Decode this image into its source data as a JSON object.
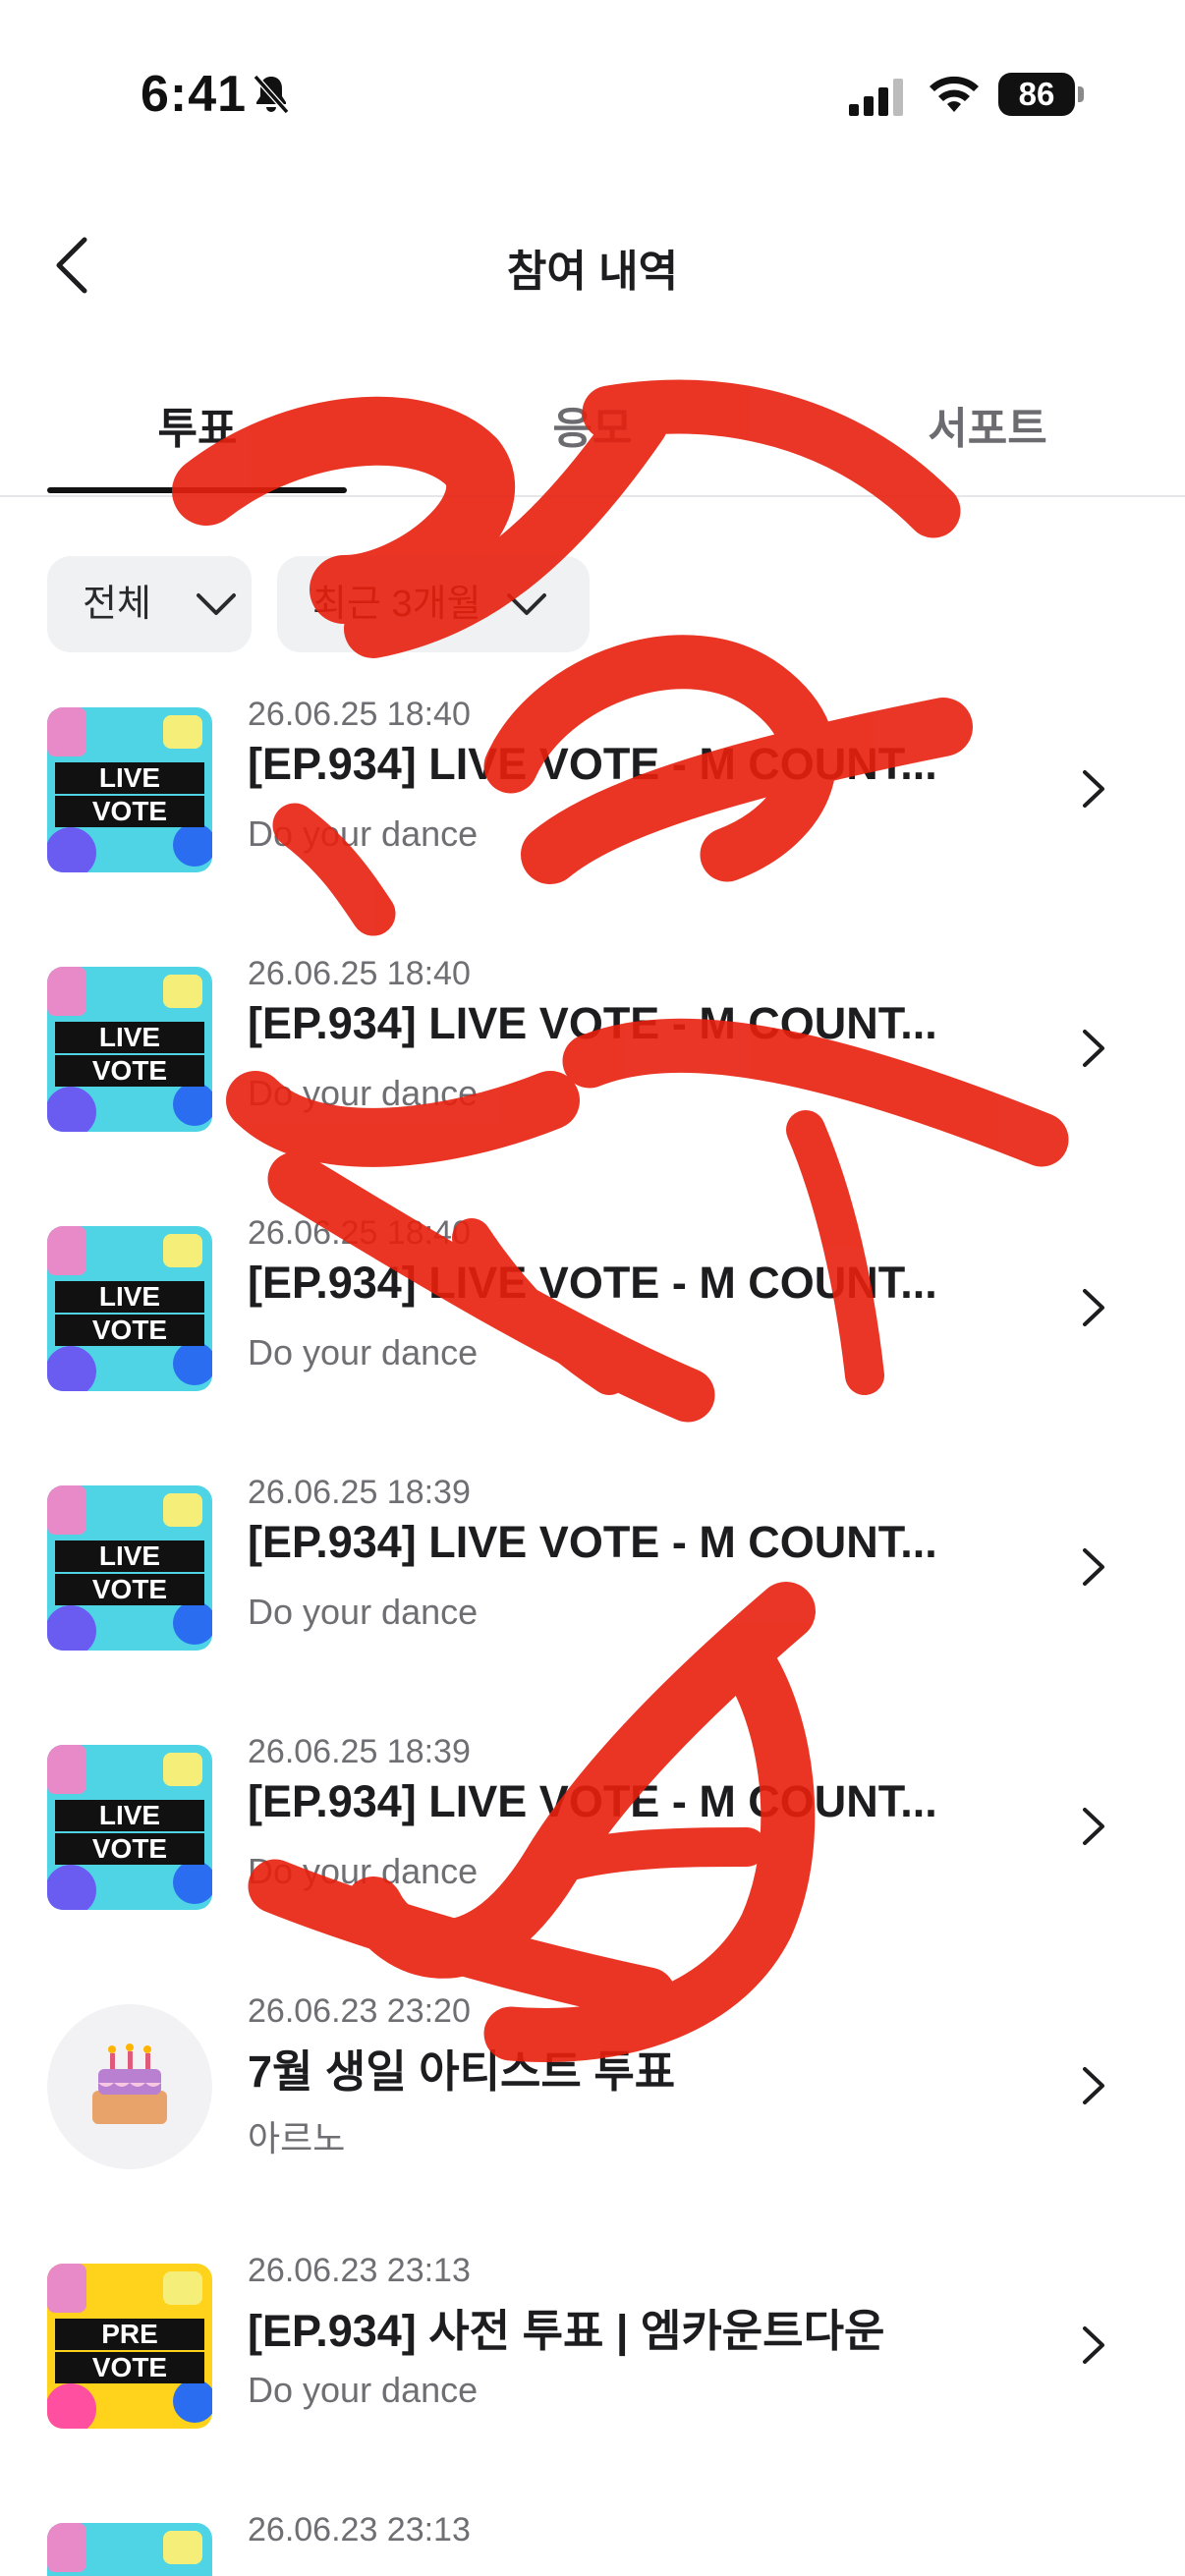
{
  "status_bar": {
    "time": "6:41",
    "battery": "86"
  },
  "header": {
    "title": "참여 내역"
  },
  "tabs": [
    {
      "label": "투표"
    },
    {
      "label": "응모"
    },
    {
      "label": "서포트"
    }
  ],
  "filters": [
    {
      "label": "전체"
    },
    {
      "label": "최근 3개월"
    }
  ],
  "items": [
    {
      "date": "26.06.25 18:40",
      "title": "[EP.934] LIVE VOTE - M COUNT...",
      "subtitle": "Do your dance",
      "thumb_line1": "LIVE",
      "thumb_line2": "VOTE"
    },
    {
      "date": "26.06.25 18:40",
      "title": "[EP.934] LIVE VOTE - M COUNT...",
      "subtitle": "Do your dance",
      "thumb_line1": "LIVE",
      "thumb_line2": "VOTE"
    },
    {
      "date": "26.06.25 18:40",
      "title": "[EP.934] LIVE VOTE - M COUNT...",
      "subtitle": "Do your dance",
      "thumb_line1": "LIVE",
      "thumb_line2": "VOTE"
    },
    {
      "date": "26.06.25 18:39",
      "title": "[EP.934] LIVE VOTE - M COUNT...",
      "subtitle": "Do your dance",
      "thumb_line1": "LIVE",
      "thumb_line2": "VOTE"
    },
    {
      "date": "26.06.25 18:39",
      "title": "[EP.934] LIVE VOTE - M COUNT...",
      "subtitle": "Do your dance",
      "thumb_line1": "LIVE",
      "thumb_line2": "VOTE"
    },
    {
      "date": "26.06.23 23:20",
      "title": "7월 생일 아티스트 투표",
      "subtitle": "아르노",
      "thumb_line1": "",
      "thumb_line2": ""
    },
    {
      "date": "26.06.23 23:13",
      "title": "[EP.934] 사전 투표 | 엠카운트다운",
      "subtitle": "Do your dance",
      "thumb_line1": "PRE",
      "thumb_line2": "VOTE"
    },
    {
      "date": "26.06.23 23:13",
      "title": "",
      "subtitle": "",
      "thumb_line1": "",
      "thumb_line2": ""
    }
  ],
  "colors": {
    "accent_text": "#1d1d1f",
    "muted_text": "#6e6e73",
    "scribble": "#e8200e"
  }
}
